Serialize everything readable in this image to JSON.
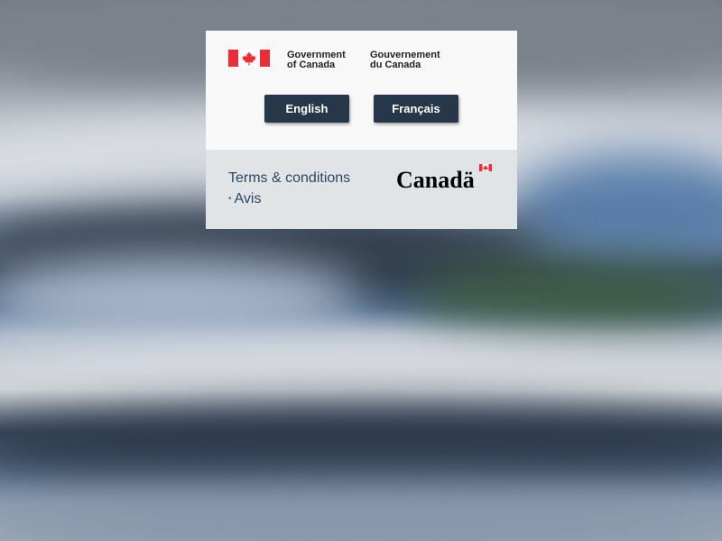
{
  "colors": {
    "button_bg": "#26374a",
    "button_text": "#ffffff",
    "link": "#294866",
    "card_top_bg": "#f8f8f8",
    "card_bottom_bg": "#e1e4e7",
    "flag_red": "#eb2d37"
  },
  "signature": {
    "en_line1": "Government",
    "en_line2": "of Canada",
    "fr_line1": "Gouvernement",
    "fr_line2": "du Canada",
    "flag_icon": "canada-flag-icon"
  },
  "buttons": {
    "english": "English",
    "francais": "Français"
  },
  "footer": {
    "terms": "Terms & conditions",
    "bullet": "•",
    "avis": "Avis",
    "wordmark": "Canadä"
  }
}
